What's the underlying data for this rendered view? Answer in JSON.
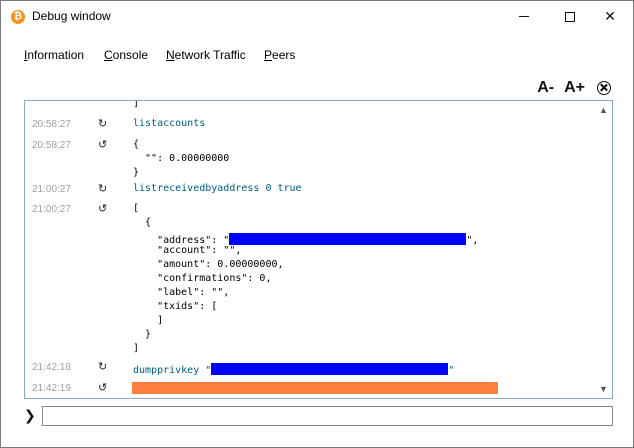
{
  "window": {
    "title": "Debug window",
    "app_icon_glyph": "₿",
    "controls": {
      "minimize_icon": "minimize-icon",
      "maximize_icon": "maximize-icon",
      "close_glyph": "✕"
    }
  },
  "tabs": [
    {
      "label": "Information",
      "underline_char": "I",
      "rest": "nformation"
    },
    {
      "label": "Console",
      "underline_char": "C",
      "rest": "onsole",
      "active": true
    },
    {
      "label": "Network Traffic",
      "underline_char": "N",
      "rest": "etwork Traffic"
    },
    {
      "label": "Peers",
      "underline_char": "P",
      "rest": "eers"
    }
  ],
  "font_controls": {
    "decrease": "A-",
    "increase": "A+",
    "clear_icon": "clear-console-icon"
  },
  "console": {
    "top_partial": "]",
    "entries": [
      {
        "time": "20:58:27",
        "direction": "request",
        "icon": "↻",
        "lines": [
          "listaccounts"
        ]
      },
      {
        "time": "20:58:27",
        "direction": "reply",
        "icon": "↺",
        "lines": [
          "{",
          "  \"\": 0.00000000",
          "}"
        ]
      },
      {
        "time": "21:00:27",
        "direction": "request",
        "icon": "↻",
        "lines": [
          "listreceivedbyaddress 0 true"
        ]
      },
      {
        "time": "21:00:27",
        "direction": "reply",
        "icon": "↺",
        "lines": [
          "[",
          "  {",
          "    \"address\": \"",
          "    \"account\": \"\",",
          "    \"amount\": 0.00000000,",
          "    \"confirmations\": 0,",
          "    \"label\": \"\",",
          "    \"txids\": [",
          "    ]",
          "  }",
          "]"
        ],
        "address_suffix": "\","
      },
      {
        "time": "21:42:18",
        "direction": "request",
        "icon": "↻",
        "lines": [
          "dumpprivkey \""
        ],
        "suffix": "\""
      },
      {
        "time": "21:42:19",
        "direction": "reply",
        "icon": "↺",
        "lines": [
          ""
        ]
      }
    ],
    "scroll_up": "▲",
    "scroll_down": "▼"
  },
  "prompt": {
    "glyph": "❯",
    "value": "",
    "placeholder": ""
  },
  "colors": {
    "redaction": "#0000ff",
    "highlight": "#ff7f3f",
    "command": "#006080",
    "timestamp": "#a0a0a0"
  }
}
